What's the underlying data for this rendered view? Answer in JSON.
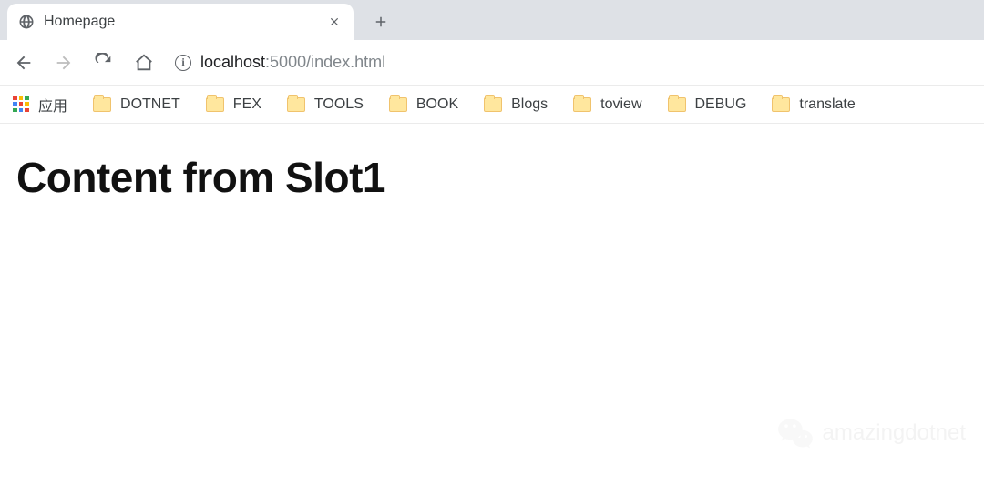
{
  "tab": {
    "title": "Homepage"
  },
  "nav": {
    "url_host": "localhost",
    "url_port_path": ":5000/index.html"
  },
  "bookmarks": {
    "apps_label": "应用",
    "items": [
      {
        "label": "DOTNET"
      },
      {
        "label": "FEX"
      },
      {
        "label": "TOOLS"
      },
      {
        "label": "BOOK"
      },
      {
        "label": "Blogs"
      },
      {
        "label": "toview"
      },
      {
        "label": "DEBUG"
      },
      {
        "label": "translate"
      }
    ]
  },
  "page": {
    "heading": "Content from Slot1"
  },
  "watermark": {
    "text": "amazingdotnet"
  }
}
